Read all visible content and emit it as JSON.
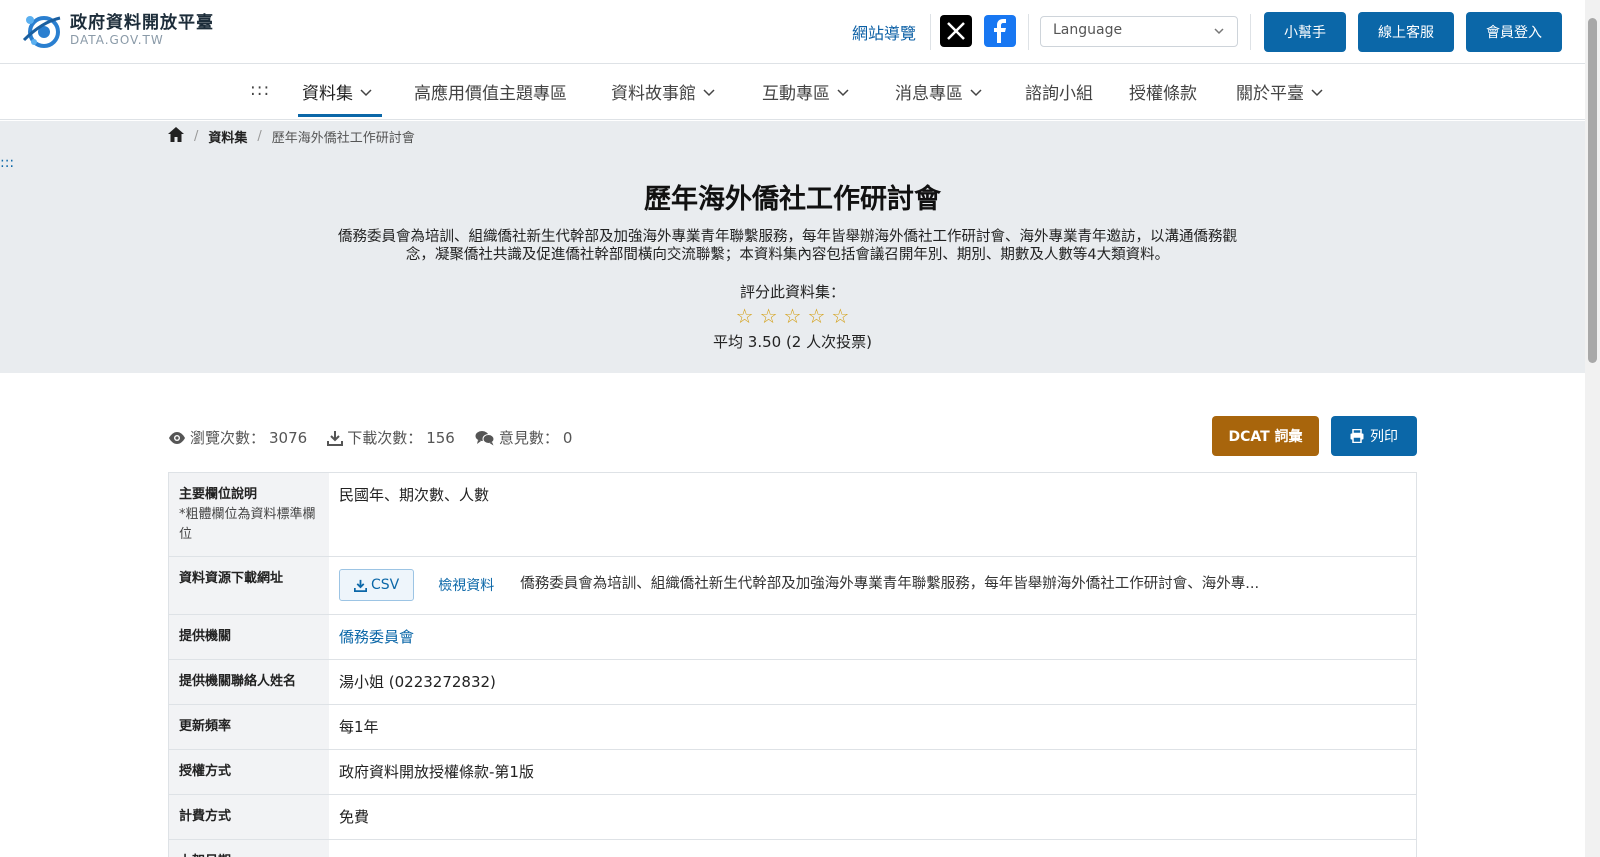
{
  "header": {
    "logo_name": "政府資料開放平臺",
    "logo_sub": "DATA.GOV.TW",
    "sitemap": "網站導覽",
    "language_placeholder": "Language",
    "buttons": {
      "helper": "小幫手",
      "service": "線上客服",
      "login": "會員登入"
    }
  },
  "nav": {
    "dots": ":::",
    "items": [
      {
        "label": "資料集",
        "dropdown": true
      },
      {
        "label": "高應用價值主題專區",
        "dropdown": false
      },
      {
        "label": "資料故事館",
        "dropdown": true
      },
      {
        "label": "互動專區",
        "dropdown": true
      },
      {
        "label": "消息專區",
        "dropdown": true
      },
      {
        "label": "諮詢小組",
        "dropdown": false
      },
      {
        "label": "授權條款",
        "dropdown": false
      },
      {
        "label": "關於平臺",
        "dropdown": true
      }
    ]
  },
  "hero": {
    "skip": ":::",
    "breadcrumb": {
      "section": "資料集",
      "current": "歷年海外僑社工作研討會"
    },
    "title": "歷年海外僑社工作研討會",
    "description": "僑務委員會為培訓、組織僑社新生代幹部及加強海外專業青年聯繫服務，每年皆舉辦海外僑社工作研討會、海外專業青年邀訪，以溝通僑務觀念，凝聚僑社共識及促進僑社幹部間橫向交流聯繫；本資料集內容包括會議召開年別、期別、期數及人數等4大類資料。",
    "rate_label": "評分此資料集：",
    "stars_total": 5,
    "average": "平均 3.50 (2 人次投票)"
  },
  "stats": {
    "views_label": "瀏覽次數：",
    "views": "3076",
    "downloads_label": "下載次數：",
    "downloads": "156",
    "comments_label": "意見數：",
    "comments": "0"
  },
  "actions": {
    "dcat": "DCAT 詞彙",
    "print": "列印"
  },
  "table": {
    "main_fields": {
      "label": "主要欄位說明",
      "note": "*粗體欄位為資料標準欄位",
      "value": "民國年、期次數、人數"
    },
    "resource": {
      "label": "資料資源下載網址",
      "format": "CSV",
      "view": "檢視資料",
      "desc": "僑務委員會為培訓、組織僑社新生代幹部及加強海外專業青年聯繫服務，每年皆舉辦海外僑社工作研討會、海外專..."
    },
    "provider": {
      "label": "提供機關",
      "value": "僑務委員會"
    },
    "contact": {
      "label": "提供機關聯絡人姓名",
      "value": "湯小姐 (0223272832)"
    },
    "frequency": {
      "label": "更新頻率",
      "value": "每1年"
    },
    "license": {
      "label": "授權方式",
      "value": "政府資料開放授權條款-第1版"
    },
    "fee": {
      "label": "計費方式",
      "value": "免費"
    },
    "next_label": "上架日期"
  },
  "colors": {
    "primary": "#0b67a8",
    "dcat": "#a8650c",
    "hero_bg": "#e9ecef",
    "star": "#d4a017"
  }
}
